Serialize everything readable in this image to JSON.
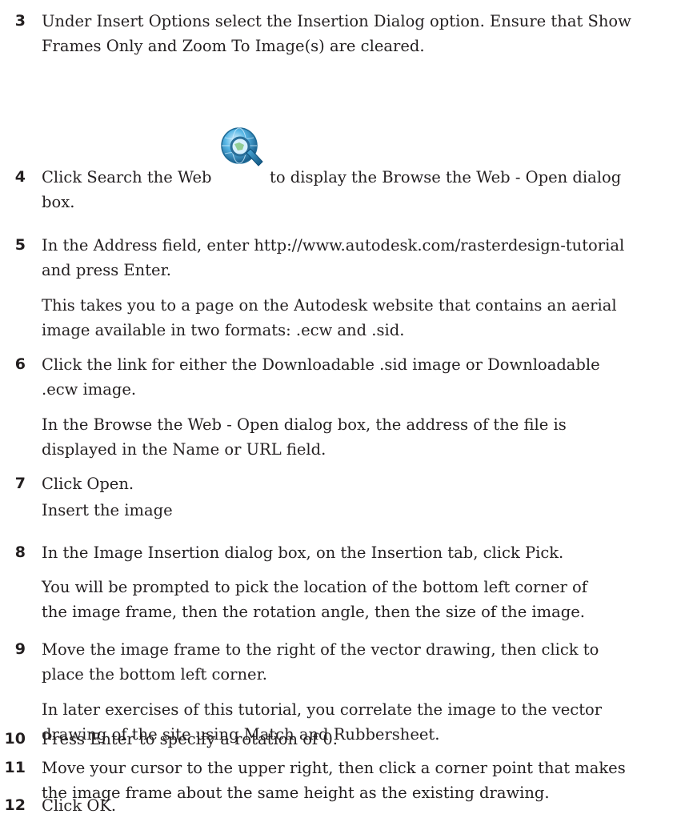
{
  "steps": [
    {
      "num": "3",
      "text": "Under Insert Options select the Insertion Dialog option. Ensure that Show\nFrames Only and Zoom To Image(s) are cleared."
    },
    {
      "num": "4",
      "text_before": "Click Search the Web",
      "icon": "search-the-web-icon",
      "text_after": "to display the Browse the Web - Open dialog",
      "text_tail": "box."
    },
    {
      "num": "5",
      "text": "In the Address field, enter http://www.autodesk.com/rasterdesign-tutorial\nand press Enter.",
      "note": "This takes you to a page on the Autodesk website that contains an aerial\nimage available in two formats: .ecw and .sid."
    },
    {
      "num": "6",
      "text": "Click the link for either the Downloadable .sid image or Downloadable\n.ecw image.",
      "note": "In the Browse the Web - Open dialog box, the address of the file is\ndisplayed in the Name or URL field."
    },
    {
      "num": "7",
      "text": "Click Open.",
      "note": "Insert the image"
    },
    {
      "num": "8",
      "text": "In the Image Insertion dialog box, on the Insertion tab, click Pick.",
      "note": "You will be prompted to pick the location of the bottom left corner of\nthe image frame, then the rotation angle, then the size of the image."
    },
    {
      "num": "9",
      "text": "Move the image frame to the right of the vector drawing, then click to\nplace the bottom left corner.",
      "note": "In later exercises of this tutorial, you correlate the image to the vector\ndrawing of the site using Match and Rubbersheet."
    },
    {
      "num": "10",
      "text": "Press Enter to specify a rotation of 0."
    },
    {
      "num": "11",
      "text": "Move your cursor to the upper right, then click a corner point that makes\nthe image frame about the same height as the existing drawing."
    },
    {
      "num": "12",
      "text": "Click OK."
    }
  ]
}
